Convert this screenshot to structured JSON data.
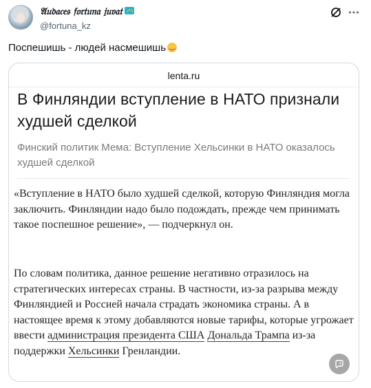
{
  "author": {
    "display_name": "𝔄𝔲𝔡𝔞𝔠𝔢𝔰 𝔣𝔬𝔯𝔱𝔲𝔫𝔞 𝔧𝔲𝔳𝔞𝔱",
    "handle": "@fortuna_kz",
    "badge_colors": {
      "background": "#2fb1c9",
      "accent": "#f1cd37"
    }
  },
  "header_icons": [
    "grok-icon",
    "more-icon"
  ],
  "tweet": {
    "text": "Поспешишь - людей насмешишь",
    "emoji": "relieved-face-emoji"
  },
  "card": {
    "domain": "lenta.ru",
    "headline": "В Финляндии вступление в НАТО признали худшей сделкой",
    "subtitle": "Финский политик Мема: Вступление Хельсинки в НАТО оказалось худшей сделкой",
    "paragraph1": "«Вступление в НАТО было худшей сделкой, которую Финляндия могла заключить. Финляндии надо было подождать, прежде чем принимать такое поспешное решение», — подчеркнул он.",
    "paragraph2": {
      "text_1": "По словам политика, данное решение негативно отразилось на стратегических интересах страны. В частности, из-за разрыва между Финляндией и Россией начала страдать экономика страны. А в настоящее время к этому добавляются новые тарифы, которые угрожает ввести ",
      "link_1": "администрация президента США",
      "text_2": " ",
      "link_2": "Дональда Трампа",
      "text_3": " из-за поддержки ",
      "link_3": "Хельсинки",
      "text_4": " Гренландии."
    },
    "badge_icon": "grok-summary-icon"
  },
  "colors": {
    "text_primary": "#0f1419",
    "text_secondary": "#536471",
    "card_border": "#cfd9de",
    "subtitle_gray": "#7a7a7a"
  }
}
